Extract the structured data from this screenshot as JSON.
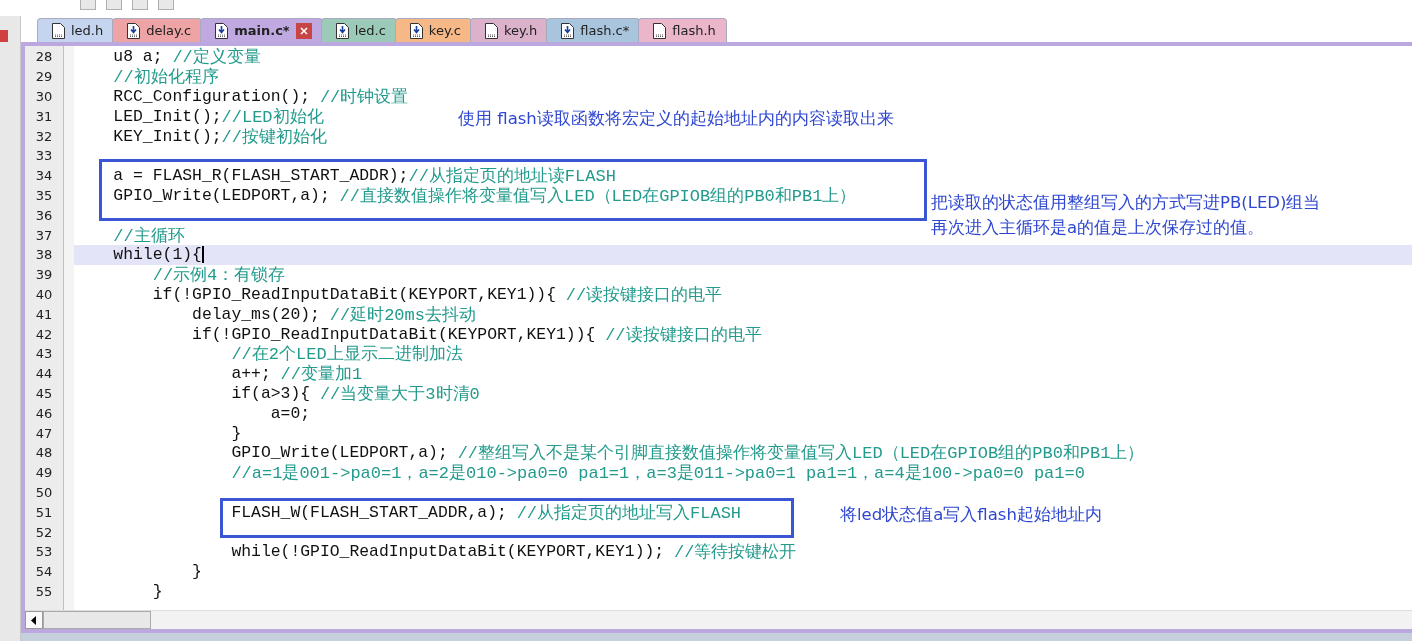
{
  "tabs": [
    {
      "label": "led.h",
      "kind": "header",
      "color": "#c5d5f0",
      "selected": false
    },
    {
      "label": "delay.c",
      "kind": "source",
      "color": "#eea4a4",
      "selected": false
    },
    {
      "label": "main.c*",
      "kind": "source",
      "color": "#bfa9e0",
      "selected": true
    },
    {
      "label": "led.c",
      "kind": "source",
      "color": "#9ccab9",
      "selected": false
    },
    {
      "label": "key.c",
      "kind": "source",
      "color": "#f6b886",
      "selected": false
    },
    {
      "label": "key.h",
      "kind": "header",
      "color": "#dbb2ca",
      "selected": false
    },
    {
      "label": "flash.c*",
      "kind": "source",
      "color": "#a9c5dd",
      "selected": false
    },
    {
      "label": "flash.h",
      "kind": "header",
      "color": "#ebb6ca",
      "selected": false
    }
  ],
  "lines": [
    {
      "number": "28",
      "code": "    u8 a; ",
      "comment": "//定义变量",
      "selected": false
    },
    {
      "number": "29",
      "comment": "    //初始化程序",
      "selected": false
    },
    {
      "number": "30",
      "code": "    RCC_Configuration(); ",
      "comment": "//时钟设置",
      "selected": false
    },
    {
      "number": "31",
      "code": "    LED_Init();",
      "comment": "//LED初始化",
      "selected": false
    },
    {
      "number": "32",
      "code": "    KEY_Init();",
      "comment": "//按键初始化",
      "selected": false
    },
    {
      "number": "33",
      "selected": false
    },
    {
      "number": "34",
      "code": "    a = FLASH_R(FLASH_START_ADDR);",
      "comment": "//从指定页的地址读FLASH",
      "selected": false
    },
    {
      "number": "35",
      "code": "    GPIO_Write(LEDPORT,a); ",
      "comment": "//直接数值操作将变量值写入LED（LED在GPIOB组的PB0和PB1上）",
      "selected": false
    },
    {
      "number": "36",
      "selected": false
    },
    {
      "number": "37",
      "comment": "    //主循环",
      "selected": false
    },
    {
      "number": "38",
      "code": "    while(1){",
      "selected": true
    },
    {
      "number": "39",
      "comment": "        //示例4：有锁存",
      "selected": false
    },
    {
      "number": "40",
      "code": "        if(!GPIO_ReadInputDataBit(KEYPORT,KEY1)){ ",
      "comment": "//读按键接口的电平",
      "selected": false
    },
    {
      "number": "41",
      "code": "            delay_ms(20); ",
      "comment": "//延时20ms去抖动",
      "selected": false
    },
    {
      "number": "42",
      "code": "            if(!GPIO_ReadInputDataBit(KEYPORT,KEY1)){ ",
      "comment": "//读按键接口的电平",
      "selected": false
    },
    {
      "number": "43",
      "comment": "                //在2个LED上显示二进制加法",
      "selected": false
    },
    {
      "number": "44",
      "code": "                a++; ",
      "comment": "//变量加1",
      "selected": false
    },
    {
      "number": "45",
      "code": "                if(a>3){ ",
      "comment": "//当变量大于3时清0",
      "selected": false
    },
    {
      "number": "46",
      "code": "                    a=0;",
      "selected": false
    },
    {
      "number": "47",
      "code": "                }",
      "selected": false
    },
    {
      "number": "48",
      "code": "                GPIO_Write(LEDPORT,a); ",
      "comment": "//整组写入不是某个引脚直接数值操作将变量值写入LED（LED在GPIOB组的PB0和PB1上）",
      "selected": false
    },
    {
      "number": "49",
      "comment": "                //a=1是001->pa0=1，a=2是010->pa0=0 pa1=1，a=3是011->pa0=1 pa1=1，a=4是100->pa0=0 pa1=0",
      "selected": false
    },
    {
      "number": "50",
      "selected": false
    },
    {
      "number": "51",
      "code": "                FLASH_W(FLASH_START_ADDR,a); ",
      "comment": "//从指定页的地址写入FLASH",
      "selected": false
    },
    {
      "number": "52",
      "selected": false
    },
    {
      "number": "53",
      "code": "                while(!GPIO_ReadInputDataBit(KEYPORT,KEY1)); ",
      "comment": "//等待按键松开",
      "selected": false
    },
    {
      "number": "54",
      "code": "            }",
      "selected": false
    },
    {
      "number": "55",
      "code": "        }",
      "selected": false
    }
  ],
  "annotations": [
    {
      "text": "使用 flash读取函数将宏定义的起始地址内的内容读取出来"
    },
    {
      "text": "把读取的状态值用整组写入的方式写进PB(LED)组当再次进入主循环是a的值是上次保存过的值。"
    },
    {
      "text": "将led状态值a写入flash起始地址内"
    }
  ]
}
